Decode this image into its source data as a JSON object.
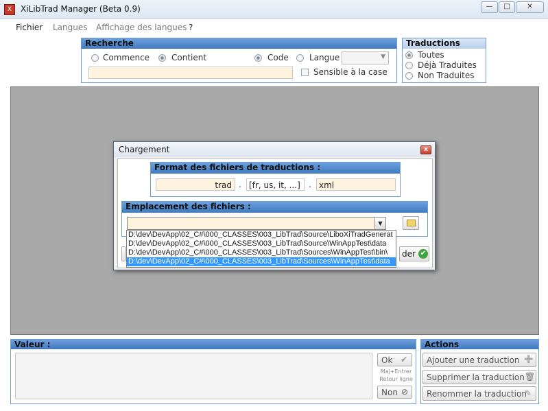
{
  "window": {
    "title": "XiLibTrad Manager (Beta 0.9)",
    "minimize": "—",
    "maximize": "□",
    "close": "✕"
  },
  "menu": [
    {
      "label": "Fichier"
    },
    {
      "label": "Langues"
    },
    {
      "label": "Affichage des langues"
    },
    {
      "label": "?"
    }
  ],
  "search": {
    "title": "Recherche",
    "options": [
      "Commence",
      "Contient",
      "Code",
      "Langue"
    ],
    "selected_mode": "Contient",
    "selected_field": "Code",
    "language_value": "",
    "search_value": "",
    "case_label": "Sensible à la case",
    "case_checked": false
  },
  "translations_filter": {
    "title": "Traductions",
    "options": [
      "Toutes",
      "Déjà Traduites",
      "Non Traduites"
    ],
    "selected": "Toutes"
  },
  "dialog": {
    "title": "Chargement",
    "format": {
      "title": "Format des fichiers de traductions :",
      "prefix": "trad",
      "sep1": ".",
      "languages": "[fr, us, it, ...]",
      "sep2": ".",
      "extension": "xml"
    },
    "location": {
      "title": "Emplacement des fichiers :",
      "value": "",
      "dropdown_items": [
        "D:\\dev\\DevApp\\02_C#\\000_CLASSES\\003_LibTrad\\Source\\LiboXiTradGenerat",
        "D:\\dev\\DevApp\\02_C#\\000_CLASSES\\003_LibTrad\\Source\\WinAppTest\\data",
        "D:\\dev\\DevApp\\02_C#\\000_CLASSES\\003_LibTrad\\Sources\\WinAppTest\\bin\\",
        "D:\\dev\\DevApp\\02_C#\\000_CLASSES\\003_LibTrad\\Sources\\WinAppTest\\data"
      ],
      "selected_index": 3
    },
    "ok_partial_label": "der"
  },
  "value_panel": {
    "title": "Valeur :",
    "value": "",
    "ok_label": "Ok",
    "hint_line1": "Maj+Entrer",
    "hint_line2": "Retour ligne",
    "cancel_label": "Non"
  },
  "actions": {
    "title": "Actions",
    "add": "Ajouter une traduction",
    "delete": "Supprimer la traduction",
    "rename": "Renommer la traduction"
  },
  "colors": {
    "accent": "#3f79c1",
    "field_bg": "#fdf3df",
    "selection": "#3399ff",
    "main_bg": "#a9a9a9"
  }
}
